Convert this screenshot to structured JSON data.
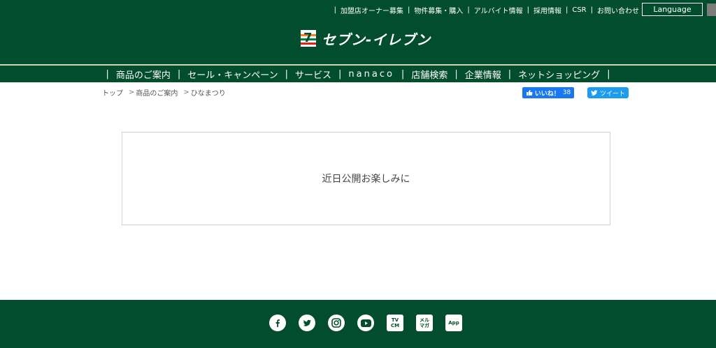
{
  "header": {
    "util_links": [
      "加盟店オーナー募集",
      "物件募集・購入",
      "アルバイト情報",
      "採用情報",
      "CSR",
      "お問い合わせ"
    ],
    "language_label": "Language",
    "logo_text": "セブン-イレブン"
  },
  "gnav": {
    "items": [
      "商品のご案内",
      "セール・キャンペーン",
      "サービス",
      "nanaco",
      "店舗検索",
      "企業情報",
      "ネットショッピング"
    ]
  },
  "breadcrumb": {
    "top": "トップ",
    "products": "商品のご案内",
    "current": "ひなまつり"
  },
  "social_share": {
    "like_label": "いいね！",
    "like_count": "38",
    "tweet_label": "ツイート"
  },
  "main": {
    "message": "近日公開お楽しみに"
  },
  "footer": {
    "icons": [
      "facebook-icon",
      "twitter-icon",
      "instagram-icon",
      "youtube-icon",
      "tv-cm-icon",
      "mail-magazine-icon",
      "app-icon"
    ],
    "tvcm_label_1": "TV",
    "tvcm_label_2": "CM",
    "mailmag_label_1": "メル",
    "mailmag_label_2": "マガ",
    "app_label": "App"
  },
  "colors": {
    "brand_green": "#024d2d",
    "nav_border": "#cfd6a8",
    "facebook_blue": "#1877f2",
    "twitter_blue": "#1d9bf0"
  }
}
